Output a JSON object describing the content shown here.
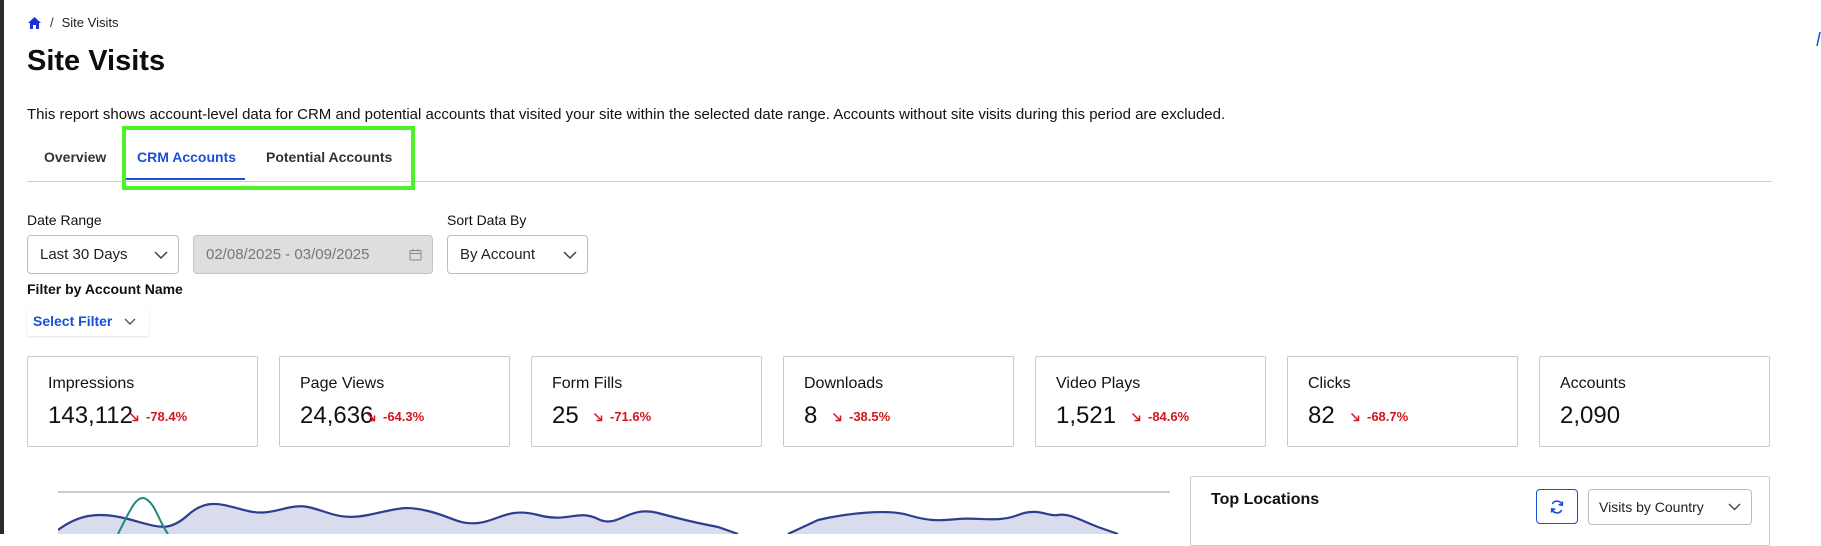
{
  "breadcrumb": {
    "home_icon": "home-icon",
    "separator": "/",
    "current": "Site Visits"
  },
  "page": {
    "title": "Site Visits",
    "description": "This report shows account-level data for CRM and potential accounts that visited your site within the selected date range. Accounts without site visits during this period are excluded."
  },
  "tabs": [
    {
      "label": "Overview",
      "active": false
    },
    {
      "label": "CRM Accounts",
      "active": true
    },
    {
      "label": "Potential Accounts",
      "active": false
    }
  ],
  "filters": {
    "date_range_label": "Date Range",
    "date_range_value": "Last 30 Days",
    "date_picker_value": "02/08/2025 - 03/09/2025",
    "sort_label": "Sort Data By",
    "sort_value": "By Account",
    "account_filter_label": "Filter by Account Name",
    "account_filter_button": "Select Filter"
  },
  "metrics": [
    {
      "title": "Impressions",
      "value": "143,112",
      "delta": "-78.4%"
    },
    {
      "title": "Page Views",
      "value": "24,636",
      "delta": "-64.3%"
    },
    {
      "title": "Form Fills",
      "value": "25",
      "delta": "-71.6%"
    },
    {
      "title": "Downloads",
      "value": "8",
      "delta": "-38.5%"
    },
    {
      "title": "Video Plays",
      "value": "1,521",
      "delta": "-84.6%"
    },
    {
      "title": "Clicks",
      "value": "82",
      "delta": "-68.7%"
    },
    {
      "title": "Accounts",
      "value": "2,090",
      "delta": ""
    }
  ],
  "top_locations": {
    "title": "Top Locations",
    "refresh_icon": "refresh-icon",
    "select_value": "Visits by Country"
  },
  "colors": {
    "accent": "#1a4fd6",
    "negative": "#d0161f",
    "highlight": "#4cf227",
    "chart_line": "#2f3d8f",
    "chart_fill": "#d9dcec",
    "chart_teal": "#1f8a7a"
  }
}
